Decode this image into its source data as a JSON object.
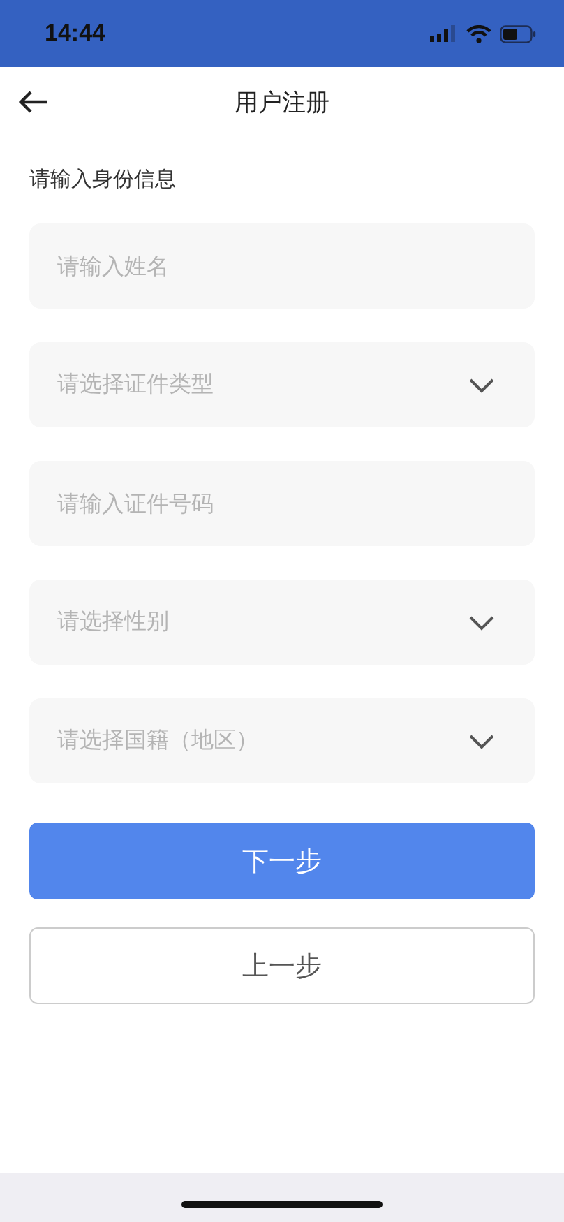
{
  "status_bar": {
    "time": "14:44"
  },
  "nav": {
    "title": "用户注册"
  },
  "section": {
    "label": "请输入身份信息"
  },
  "fields": [
    {
      "kind": "input",
      "placeholder": "请输入姓名"
    },
    {
      "kind": "select",
      "placeholder": "请选择证件类型"
    },
    {
      "kind": "input",
      "placeholder": "请输入证件号码"
    },
    {
      "kind": "select",
      "placeholder": "请选择性别"
    },
    {
      "kind": "select",
      "placeholder": "请选择国籍（地区）"
    }
  ],
  "buttons": [
    {
      "kind": "primary",
      "label": "下一步"
    },
    {
      "kind": "secondary",
      "label": "上一步"
    }
  ]
}
